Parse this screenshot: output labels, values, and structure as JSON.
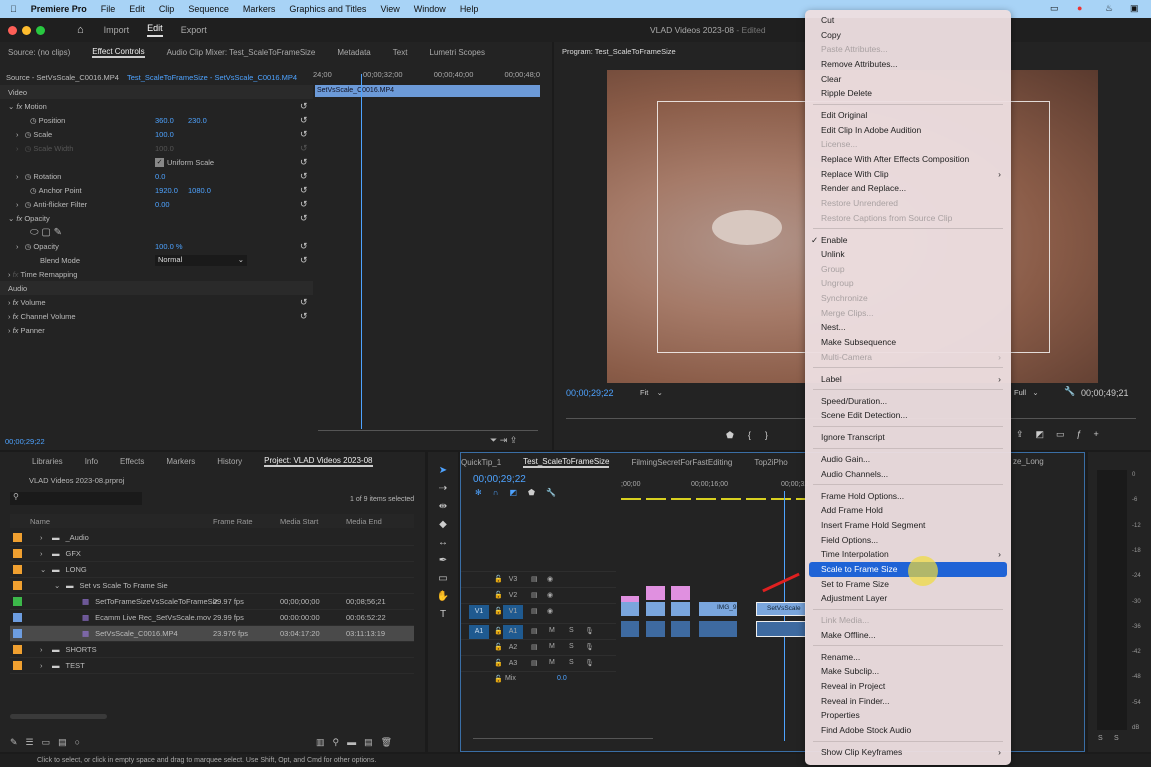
{
  "menubar": {
    "app": "Premiere Pro",
    "items": [
      "File",
      "Edit",
      "Clip",
      "Sequence",
      "Markers",
      "Graphics and Titles",
      "View",
      "Window",
      "Help"
    ]
  },
  "titlebar": {
    "nav": [
      "Import",
      "Edit",
      "Export"
    ],
    "active": "Edit",
    "title": "VLAD Videos 2023-08",
    "edited": " - Edited"
  },
  "source_tabs": [
    "Source: (no clips)",
    "Effect Controls",
    "Audio Clip Mixer: Test_ScaleToFrameSize",
    "Metadata",
    "Text",
    "Lumetri Scopes"
  ],
  "effect_controls": {
    "source": "Source - SetVsScale_C0016.MP4",
    "sequence": "Test_ScaleToFrameSize - SetVsScale_C0016.MP4",
    "ruler": [
      "24;00",
      "00;00;32;00",
      "00;00;40;00",
      "00;00;48;0"
    ],
    "clip": "SetVsScale_C0016.MP4",
    "video_label": "Video",
    "audio_label": "Audio",
    "motion": "Motion",
    "position_label": "Position",
    "position": [
      "360.0",
      "230.0"
    ],
    "scale_label": "Scale",
    "scale": "100.0",
    "scale_width_label": "Scale Width",
    "scale_width": "100.0",
    "uniform_scale": "Uniform Scale",
    "rotation_label": "Rotation",
    "rotation": "0.0",
    "anchor_label": "Anchor Point",
    "anchor": [
      "1920.0",
      "1080.0"
    ],
    "antiflicker_label": "Anti-flicker Filter",
    "antiflicker": "0.00",
    "opacity_group": "Opacity",
    "opacity_label": "Opacity",
    "opacity": "100.0 %",
    "blend_label": "Blend Mode",
    "blend": "Normal",
    "time_remap": "Time Remapping",
    "volume": "Volume",
    "channel_volume": "Channel Volume",
    "panner": "Panner",
    "timecode": "00;00;29;22"
  },
  "program": {
    "title": "Program: Test_ScaleToFrameSize",
    "timecode": "00;00;29;22",
    "fit": "Fit",
    "quality": "Full",
    "duration": "00;00;49;21"
  },
  "project_tabs": [
    "Libraries",
    "Info",
    "Effects",
    "Markers",
    "History",
    "Project: VLAD Videos 2023-08"
  ],
  "project": {
    "file": "VLAD Videos 2023-08.prproj",
    "selected": "1 of 9 items selected",
    "columns": [
      "Name",
      "Frame Rate",
      "Media Start",
      "Media End"
    ],
    "rows": [
      {
        "name": "_Audio",
        "color": "#f0a030",
        "indent": 0,
        "type": "folder",
        "exp": "›"
      },
      {
        "name": "GFX",
        "color": "#f0a030",
        "indent": 0,
        "type": "folder",
        "exp": "›"
      },
      {
        "name": "LONG",
        "color": "#f0a030",
        "indent": 0,
        "type": "folder",
        "exp": "⌄"
      },
      {
        "name": "Set vs Scale To Frame Sie",
        "color": "#f0a030",
        "indent": 1,
        "type": "folder",
        "exp": "⌄"
      },
      {
        "name": "SetToFrameSizeVsScaleToFrameSiz",
        "color": "#3cb84a",
        "indent": 2,
        "type": "sequence",
        "fps": "29.97 fps",
        "start": "00;00;00;00",
        "end": "00;08;56;21"
      },
      {
        "name": "Ecamm Live Rec_SetVsScale.mov",
        "color": "#6d9de0",
        "indent": 2,
        "type": "clip",
        "fps": "29.99 fps",
        "start": "00:00:00:00",
        "end": "00:06:52:22"
      },
      {
        "name": "SetVsScale_C0016.MP4",
        "color": "#6d9de0",
        "indent": 2,
        "type": "clip",
        "fps": "23.976 fps",
        "start": "03:04:17:20",
        "end": "03:11:13:19",
        "selected": true
      },
      {
        "name": "SHORTS",
        "color": "#f0a030",
        "indent": 0,
        "type": "folder",
        "exp": "›"
      },
      {
        "name": "TEST",
        "color": "#f0a030",
        "indent": 0,
        "type": "folder",
        "exp": "›"
      }
    ]
  },
  "timeline": {
    "tabs": [
      "QuickTip_1",
      "Test_ScaleToFrameSize",
      "FilmingSecretForFastEditing",
      "Top2iPho",
      "ze_Long"
    ],
    "timecode": "00;00;29;22",
    "ruler": [
      ";00;00",
      "00;00;16;00",
      "00;00;32"
    ],
    "tracks": [
      {
        "src": "",
        "name": "V3"
      },
      {
        "src": "",
        "name": "V2"
      },
      {
        "src": "V1",
        "name": "V1"
      },
      {
        "src": "A1",
        "name": "A1"
      },
      {
        "src": "",
        "name": "A2"
      },
      {
        "src": "",
        "name": "A3"
      }
    ],
    "mix_label": "Mix",
    "mix": "0.0",
    "clip_img": "IMG_9",
    "clip_set": "SetVsScale"
  },
  "meter": {
    "ticks": [
      "0",
      "-6",
      "-12",
      "-18",
      "-24",
      "-30",
      "-36",
      "-42",
      "-48",
      "-54",
      "dB"
    ],
    "solo": [
      "S",
      "S"
    ]
  },
  "status": "Click to select, or click in empty space and drag to marquee select. Use Shift, Opt, and Cmd for other options.",
  "context_menu": [
    {
      "label": "Cut"
    },
    {
      "label": "Copy"
    },
    {
      "label": "Paste Attributes...",
      "disabled": true
    },
    {
      "label": "Remove Attributes..."
    },
    {
      "label": "Clear"
    },
    {
      "label": "Ripple Delete"
    },
    {
      "sep": true
    },
    {
      "label": "Edit Original"
    },
    {
      "label": "Edit Clip In Adobe Audition"
    },
    {
      "label": "License...",
      "disabled": true
    },
    {
      "label": "Replace With After Effects Composition"
    },
    {
      "label": "Replace With Clip",
      "submenu": true
    },
    {
      "label": "Render and Replace..."
    },
    {
      "label": "Restore Unrendered",
      "disabled": true
    },
    {
      "label": "Restore Captions from Source Clip",
      "disabled": true
    },
    {
      "sep": true
    },
    {
      "label": "Enable",
      "checked": true
    },
    {
      "label": "Unlink"
    },
    {
      "label": "Group",
      "disabled": true
    },
    {
      "label": "Ungroup",
      "disabled": true
    },
    {
      "label": "Synchronize",
      "disabled": true
    },
    {
      "label": "Merge Clips...",
      "disabled": true
    },
    {
      "label": "Nest..."
    },
    {
      "label": "Make Subsequence"
    },
    {
      "label": "Multi-Camera",
      "disabled": true,
      "submenu": true
    },
    {
      "sep": true
    },
    {
      "label": "Label",
      "submenu": true
    },
    {
      "sep": true
    },
    {
      "label": "Speed/Duration..."
    },
    {
      "label": "Scene Edit Detection..."
    },
    {
      "sep": true
    },
    {
      "label": "Ignore Transcript"
    },
    {
      "sep": true
    },
    {
      "label": "Audio Gain..."
    },
    {
      "label": "Audio Channels..."
    },
    {
      "sep": true
    },
    {
      "label": "Frame Hold Options..."
    },
    {
      "label": "Add Frame Hold"
    },
    {
      "label": "Insert Frame Hold Segment"
    },
    {
      "label": "Field Options..."
    },
    {
      "label": "Time Interpolation",
      "submenu": true
    },
    {
      "label": "Scale to Frame Size",
      "highlighted": true
    },
    {
      "label": "Set to Frame Size"
    },
    {
      "label": "Adjustment Layer"
    },
    {
      "sep": true
    },
    {
      "label": "Link Media...",
      "disabled": true
    },
    {
      "label": "Make Offline..."
    },
    {
      "sep": true
    },
    {
      "label": "Rename..."
    },
    {
      "label": "Make Subclip..."
    },
    {
      "label": "Reveal in Project"
    },
    {
      "label": "Reveal in Finder..."
    },
    {
      "label": "Properties"
    },
    {
      "label": "Find Adobe Stock Audio"
    },
    {
      "sep": true
    },
    {
      "label": "Show Clip Keyframes",
      "submenu": true
    }
  ]
}
